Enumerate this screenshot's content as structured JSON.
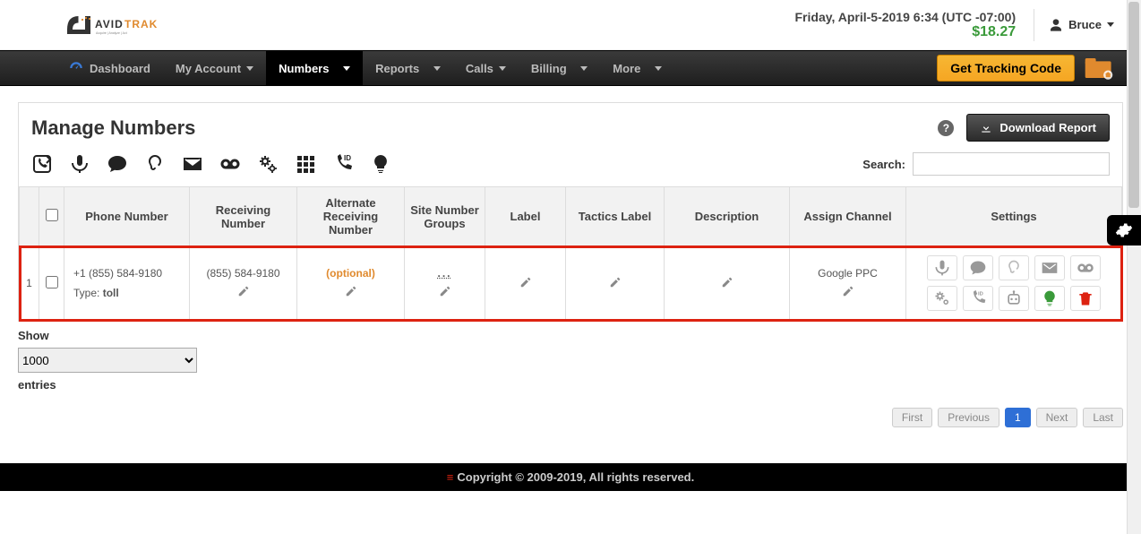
{
  "header": {
    "date_line": "Friday, April-5-2019 6:34 (UTC -07:00)",
    "balance": "$18.27",
    "user_name": "Bruce"
  },
  "nav": {
    "dashboard": "Dashboard",
    "my_account": "My Account",
    "numbers": "Numbers",
    "reports": "Reports",
    "calls": "Calls",
    "billing": "Billing",
    "more": "More",
    "tracking_btn": "Get Tracking Code"
  },
  "panel": {
    "title": "Manage Numbers",
    "download": "Download Report",
    "search_label": "Search:"
  },
  "table": {
    "headers": {
      "idx": "",
      "chk": "",
      "phone": "Phone Number",
      "receiving": "Receiving Number",
      "alt_receiving": "Alternate Receiving Number",
      "site_groups": "Site Number Groups",
      "label": "Label",
      "tactics": "Tactics Label",
      "description": "Description",
      "channel": "Assign Channel",
      "settings": "Settings"
    },
    "rows": [
      {
        "idx": "1",
        "phone_display": "+1 (855) 584-9180",
        "type_label": "Type:",
        "type_value": "toll",
        "receiving": "(855) 584-9180",
        "alt_receiving": "(optional)",
        "site_groups": "...",
        "label": "",
        "tactics": "",
        "description": "",
        "channel": "Google PPC"
      }
    ]
  },
  "below": {
    "show": "Show",
    "entries": "entries",
    "page_size": "1000"
  },
  "pager": {
    "first": "First",
    "prev": "Previous",
    "page": "1",
    "next": "Next",
    "last": "Last"
  },
  "footer": {
    "text": "Copyright © 2009-2019, All rights reserved."
  }
}
